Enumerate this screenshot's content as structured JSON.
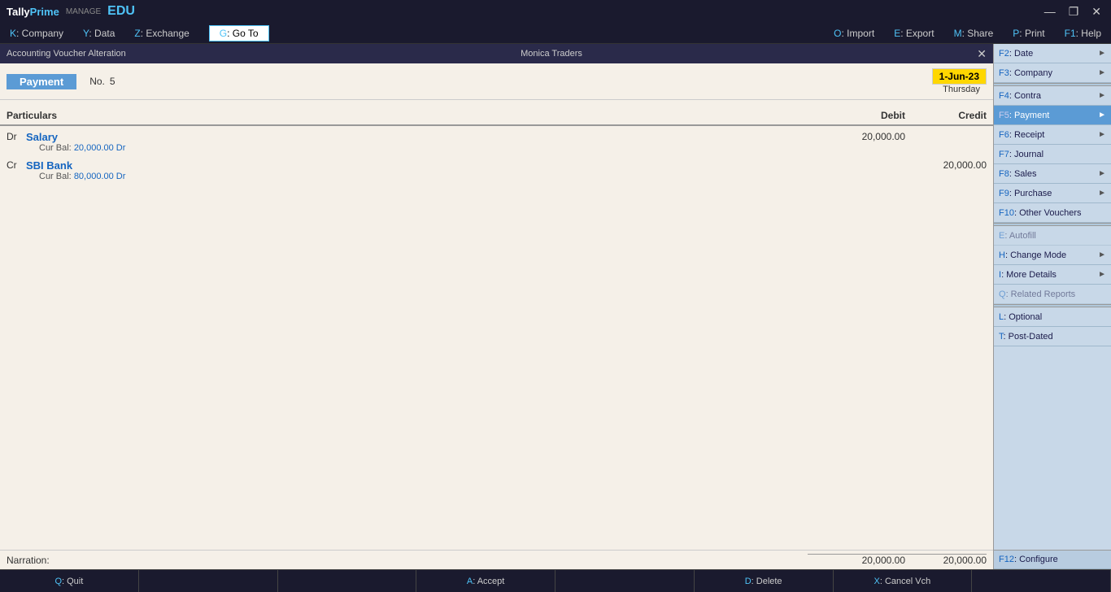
{
  "app": {
    "name": "Tally",
    "name_prime": "Prime",
    "edu": "EDU",
    "manage_label": "MANAGE"
  },
  "title_controls": {
    "minimize": "—",
    "maximize": "❐",
    "close": "✕"
  },
  "menu": {
    "items": [
      {
        "hotkey": "K",
        "label": "Company"
      },
      {
        "hotkey": "Y",
        "label": "Data"
      },
      {
        "hotkey": "Z",
        "label": "Exchange"
      }
    ],
    "goto": {
      "hotkey": "G",
      "label": "Go To"
    },
    "right_items": [
      {
        "hotkey": "O",
        "label": "Import"
      },
      {
        "hotkey": "E",
        "label": "Export"
      },
      {
        "hotkey": "M",
        "label": "Share"
      },
      {
        "hotkey": "P",
        "label": "Print"
      },
      {
        "hotkey": "F1",
        "label": "Help"
      }
    ]
  },
  "voucher": {
    "window_title": "Accounting Voucher Alteration",
    "company": "Monica Traders",
    "type": "Payment",
    "number_label": "No.",
    "number": "5",
    "date": "1-Jun-23",
    "day": "Thursday"
  },
  "table": {
    "col_particulars": "Particulars",
    "col_debit": "Debit",
    "col_credit": "Credit"
  },
  "entries": [
    {
      "dc": "Dr",
      "name": "Salary",
      "balance_label": "Cur Bal:",
      "balance": "20,000.00 Dr",
      "debit": "20,000.00",
      "credit": ""
    },
    {
      "dc": "Cr",
      "name": "SBI Bank",
      "balance_label": "Cur Bal:",
      "balance": "80,000.00 Dr",
      "debit": "",
      "credit": "20,000.00"
    }
  ],
  "narration": {
    "label": "Narration:",
    "debit_total": "20,000.00",
    "credit_total": "20,000.00"
  },
  "right_panel": {
    "items": [
      {
        "id": "f2",
        "hotkey": "F2",
        "label": "Date",
        "arrow": true,
        "disabled": false
      },
      {
        "id": "f3",
        "hotkey": "F3",
        "label": "Company",
        "arrow": true,
        "disabled": false
      },
      {
        "id": "f4",
        "hotkey": "F4",
        "label": "Contra",
        "arrow": true,
        "disabled": false
      },
      {
        "id": "f5",
        "hotkey": "F5",
        "label": "Payment",
        "arrow": true,
        "disabled": false,
        "active": true
      },
      {
        "id": "f6",
        "hotkey": "F6",
        "label": "Receipt",
        "arrow": true,
        "disabled": false
      },
      {
        "id": "f7",
        "hotkey": "F7",
        "label": "Journal",
        "arrow": false,
        "disabled": false
      },
      {
        "id": "f8",
        "hotkey": "F8",
        "label": "Sales",
        "arrow": true,
        "disabled": false
      },
      {
        "id": "f9",
        "hotkey": "F9",
        "label": "Purchase",
        "arrow": true,
        "disabled": false
      },
      {
        "id": "f10",
        "hotkey": "F10",
        "label": "Other Vouchers",
        "arrow": false,
        "disabled": false
      }
    ],
    "items2": [
      {
        "id": "e",
        "hotkey": "E",
        "label": "Autofill",
        "arrow": false,
        "disabled": true
      },
      {
        "id": "h",
        "hotkey": "H",
        "label": "Change Mode",
        "arrow": true,
        "disabled": false
      },
      {
        "id": "i",
        "hotkey": "I",
        "label": "More Details",
        "arrow": true,
        "disabled": false
      },
      {
        "id": "q",
        "hotkey": "Q",
        "label": "Related Reports",
        "arrow": false,
        "disabled": true
      }
    ],
    "items3": [
      {
        "id": "l",
        "hotkey": "L",
        "label": "Optional",
        "arrow": false,
        "disabled": false
      },
      {
        "id": "t",
        "hotkey": "T",
        "label": "Post-Dated",
        "arrow": false,
        "disabled": false
      }
    ],
    "bottom": {
      "hotkey": "F12",
      "label": "Configure"
    }
  },
  "bottom_bar": {
    "buttons": [
      {
        "hotkey": "Q",
        "label": "Quit"
      },
      {
        "hotkey": "",
        "label": ""
      },
      {
        "hotkey": "",
        "label": ""
      },
      {
        "hotkey": "A",
        "label": "Accept"
      },
      {
        "hotkey": "",
        "label": ""
      },
      {
        "hotkey": "D",
        "label": "Delete"
      },
      {
        "hotkey": "X",
        "label": "Cancel Vch"
      },
      {
        "hotkey": "",
        "label": ""
      }
    ]
  }
}
